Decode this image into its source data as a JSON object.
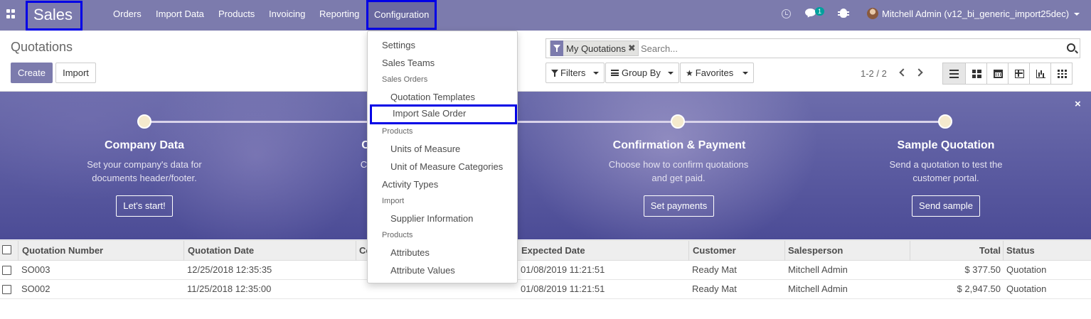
{
  "navbar": {
    "brand": "Sales",
    "menu": [
      {
        "label": "Orders"
      },
      {
        "label": "Import Data"
      },
      {
        "label": "Products"
      },
      {
        "label": "Invoicing"
      },
      {
        "label": "Reporting"
      },
      {
        "label": "Configuration"
      }
    ],
    "chat_badge": "1",
    "user": "Mitchell Admin (v12_bi_generic_import25dec)"
  },
  "control_panel": {
    "title": "Quotations",
    "create_label": "Create",
    "import_label": "Import",
    "search": {
      "facet": "My Quotations",
      "facet_remove": "✖",
      "placeholder": "Search..."
    },
    "filters_label": "Filters",
    "groupby_label": "Group By",
    "favorites_label": "Favorites",
    "pager": "1-2 / 2"
  },
  "configuration_menu": {
    "settings": "Settings",
    "sales_teams": "Sales Teams",
    "header_sales_orders": "Sales Orders",
    "quotation_templates": "Quotation Templates",
    "import_sale_order": "Import Sale Order",
    "header_products": "Products",
    "units_of_measure": "Units of Measure",
    "uom_categories": "Unit of Measure Categories",
    "activity_types": "Activity Types",
    "header_import": "Import",
    "supplier_information": "Supplier Information",
    "header_products_2": "Products",
    "attributes": "Attributes",
    "attribute_values": "Attribute Values"
  },
  "onboarding": {
    "close": "×",
    "steps": [
      {
        "title": "Company Data",
        "desc_1": "Set your company's data for",
        "desc_2": "documents header/footer.",
        "button": "Let's start!"
      },
      {
        "title": "C",
        "desc_1": "Cu",
        "desc_2": "",
        "button": ""
      },
      {
        "title": "Confirmation & Payment",
        "desc_1": "Choose how to confirm quotations",
        "desc_2": "and get paid.",
        "button": "Set payments"
      },
      {
        "title": "Sample Quotation",
        "desc_1": "Send a quotation to test the",
        "desc_2": "customer portal.",
        "button": "Send sample"
      }
    ]
  },
  "list": {
    "columns": {
      "number": "Quotation Number",
      "date": "Quotation Date",
      "commitment": "Co",
      "expected": "Expected Date",
      "customer": "Customer",
      "salesperson": "Salesperson",
      "total": "Total",
      "status": "Status"
    },
    "rows": [
      {
        "number": "SO003",
        "date": "12/25/2018 12:35:35",
        "expected": "01/08/2019 11:21:51",
        "customer": "Ready Mat",
        "salesperson": "Mitchell Admin",
        "total": "$ 377.50",
        "status": "Quotation"
      },
      {
        "number": "SO002",
        "date": "11/25/2018 12:35:00",
        "expected": "01/08/2019 11:21:51",
        "customer": "Ready Mat",
        "salesperson": "Mitchell Admin",
        "total": "$ 2,947.50",
        "status": "Quotation"
      }
    ]
  }
}
